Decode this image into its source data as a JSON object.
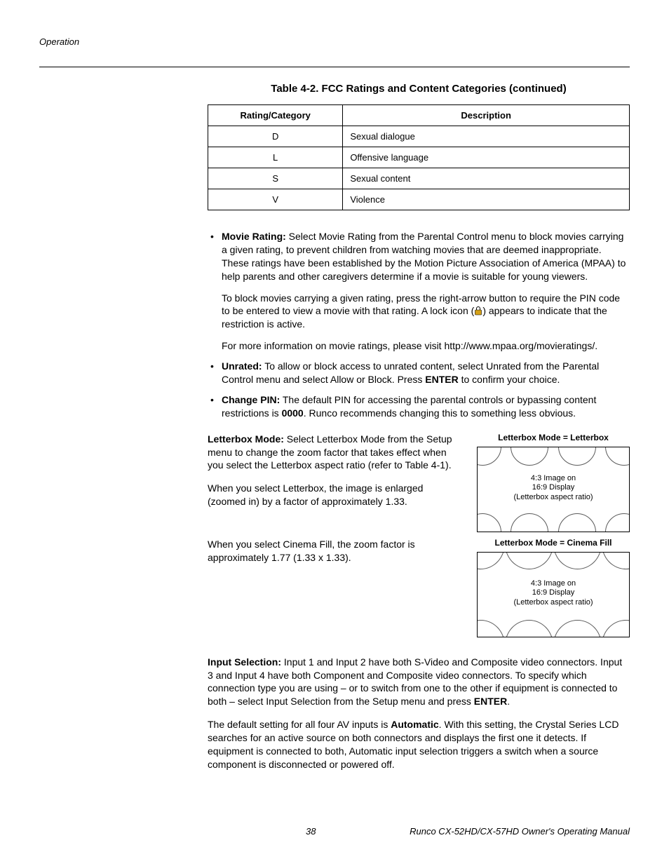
{
  "header": {
    "section": "Operation"
  },
  "table": {
    "title": "Table 4-2. FCC Ratings and Content Categories (continued)",
    "headers": {
      "col1": "Rating/Category",
      "col2": "Description"
    },
    "rows": [
      {
        "cat": "D",
        "desc": "Sexual dialogue"
      },
      {
        "cat": "L",
        "desc": "Offensive language"
      },
      {
        "cat": "S",
        "desc": "Sexual content"
      },
      {
        "cat": "V",
        "desc": "Violence"
      }
    ]
  },
  "bullets": {
    "movie_rating_label": "Movie Rating:",
    "movie_rating_text": " Select Movie Rating from the Parental Control menu to block movies carrying a given rating, to prevent children from watching movies that are deemed inappropriate. These ratings have been established by the Motion Picture Association of America (MPAA) to help parents and other caregivers determine if a movie is suitable for young viewers.",
    "movie_rating_p2a": "To block movies carrying a given rating, press the right-arrow button to require the PIN code to be entered to view a movie with that rating. A lock icon (",
    "movie_rating_p2b": ") appears to indicate that the restriction is active.",
    "movie_rating_p3": "For more information on movie ratings, please visit http://www.mpaa.org/movieratings/.",
    "unrated_label": "Unrated:",
    "unrated_text_a": " To allow or block access to unrated content, select Unrated from the Parental Control menu and select Allow or Block. Press ",
    "unrated_enter": "ENTER",
    "unrated_text_b": " to confirm your choice.",
    "change_pin_label": "Change PIN:",
    "change_pin_text_a": " The default PIN for accessing the parental controls or bypassing content restrictions is ",
    "change_pin_value": "0000",
    "change_pin_text_b": ". Runco recommends changing this to something less obvious."
  },
  "letterbox": {
    "heading": "Letterbox Mode:",
    "p1": " Select Letterbox Mode from the Setup menu to change the zoom factor that takes effect when you select the Letterbox aspect ratio (refer to Table 4-1).",
    "p2": "When you select Letterbox, the image is enlarged (zoomed in) by a factor of approximately 1.33.",
    "p3": "When you select Cinema Fill, the zoom factor is approximately 1.77 (1.33 x 1.33).",
    "diag1_label": "Letterbox Mode = Letterbox",
    "diag2_label": "Letterbox Mode = Cinema Fill",
    "diag_line1": "4:3 Image on",
    "diag_line2": "16:9 Display",
    "diag_line3": "(Letterbox aspect ratio)"
  },
  "input_selection": {
    "heading": "Input Selection:",
    "p1_a": " Input 1 and Input 2 have both S-Video and Composite video connectors. Input 3 and Input 4 have both Component and Composite video connectors. To specify which connection type you are using – or to switch from one to the other if equipment is connected to both – select Input Selection from the Setup menu and press ",
    "enter": "ENTER",
    "p1_b": ".",
    "p2_a": "The default setting for all four AV inputs is ",
    "auto": "Automatic",
    "p2_b": ". With this setting, the Crystal Series LCD searches for an active source on both connectors and displays the first one it detects. If equipment is connected to both, Automatic input selection triggers a switch when a source component is disconnected or powered off."
  },
  "footer": {
    "page_number": "38",
    "manual": "Runco CX-52HD/CX-57HD Owner's Operating Manual"
  }
}
